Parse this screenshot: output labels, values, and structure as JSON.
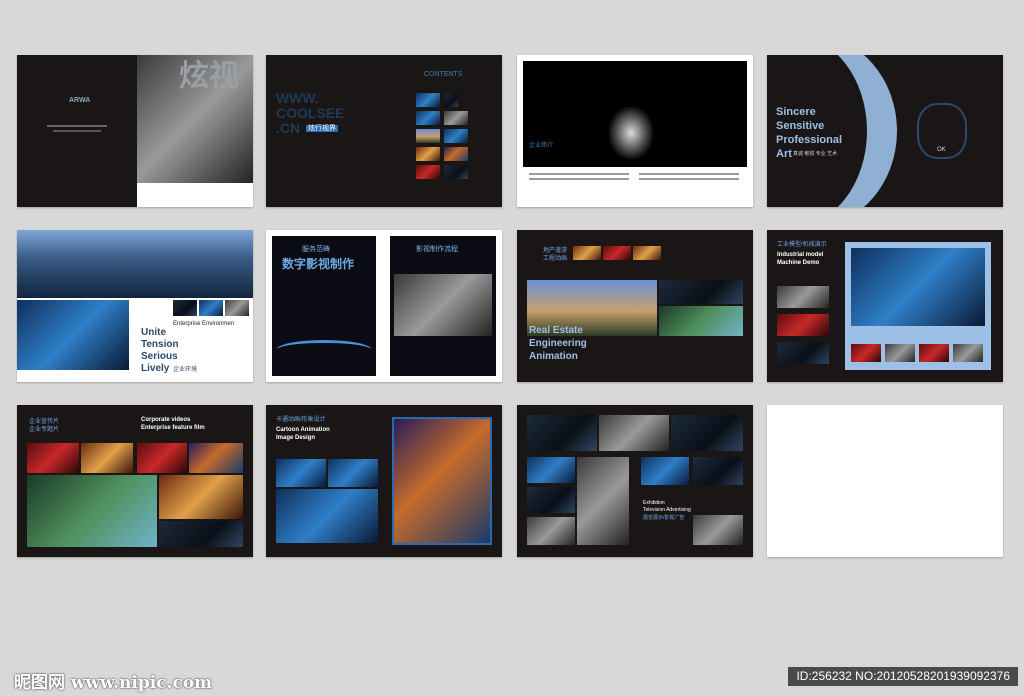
{
  "spreads": {
    "s1": {
      "logo": "ARWA",
      "title": "炫视"
    },
    "s2": {
      "contents": "CONTENTS",
      "www": "WWW.",
      "coolsee": "COOLSEE",
      "cn": ".CN",
      "tag": "炫行视界"
    },
    "s3": {
      "caption": "企业简介"
    },
    "s4": {
      "line1": "Sincere",
      "line2": "Sensitive",
      "line3": "Professional",
      "line4": "Art",
      "sub": "真诚 敏锐 专业 艺术",
      "badge": "OK"
    },
    "s5": {
      "env": "Enterprise Environmen",
      "line1": "Unite",
      "line2": "Tension",
      "line3": "Serious",
      "line4": "Lively",
      "sub": "企业环境"
    },
    "s6": {
      "small": "服务范畴",
      "title": "数字影视制作",
      "right_title": "影视制作流程"
    },
    "s7": {
      "cn_title": "地产漫游",
      "cn_sub": "工程动画",
      "line1": "Real Estate",
      "line2": "Engineering",
      "line3": "Animation"
    },
    "s8": {
      "cn_title": "工业模型/机械演示",
      "line1": "Industrial model",
      "line2": "Machine Demo"
    },
    "s9": {
      "cn_a": "企业宣传片",
      "cn_b": "企业专题片",
      "line1": "Corporate videos",
      "line2": "Enterprise feature film"
    },
    "s10": {
      "cn_title": "卡通动画/形象设计",
      "line1": "Cartoon Animation",
      "line2": "Image Design"
    },
    "s11": {
      "line1": "Exhibition",
      "line2": "Television Advertising",
      "cn": "展览展示/影视广告"
    }
  },
  "watermark": {
    "site": "昵图网 www.nipic.com",
    "id": "ID:256232 NO:20120528201939092376"
  }
}
